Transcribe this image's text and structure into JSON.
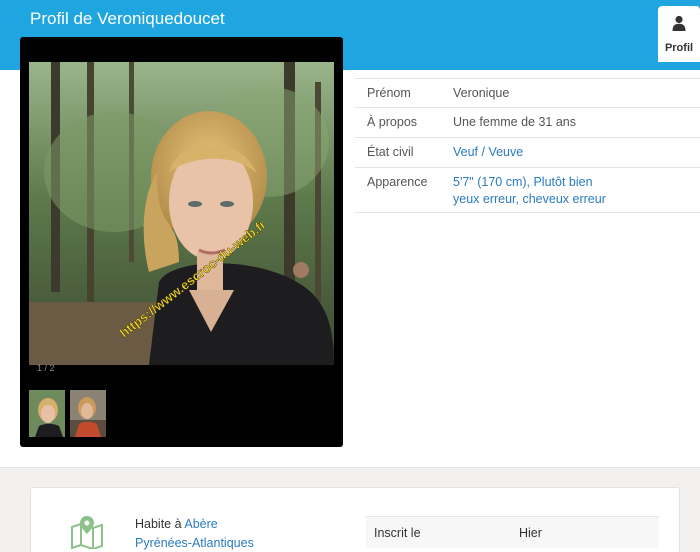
{
  "header": {
    "title": "Profil de Veroniquedoucet",
    "tab_label": "Profil",
    "tab_icon": "user-icon",
    "color": "#1fa6e0"
  },
  "gallery": {
    "counter": "1 / 2",
    "watermark": "https://www.escroc-du-web.fr",
    "thumbnails": [
      "photo-1",
      "photo-2"
    ]
  },
  "profile": {
    "rows": [
      {
        "label": "Prénom",
        "value": "Veronique",
        "link": false
      },
      {
        "label": "À propos",
        "value": "Une femme de 31 ans",
        "link": false
      },
      {
        "label": "État civil",
        "value": "Veuf / Veuve",
        "link": true
      },
      {
        "label": "Apparence",
        "value": "5'7\" (170 cm), Plutôt bien",
        "value2": "yeux erreur, cheveux erreur",
        "link": true
      }
    ]
  },
  "location": {
    "icon": "map-pin-icon",
    "prefix": "Habite à",
    "city": "Abère",
    "region": "Pyrénées-Atlantiques"
  },
  "registration": {
    "label": "Inscrit le",
    "value": "Hier"
  }
}
